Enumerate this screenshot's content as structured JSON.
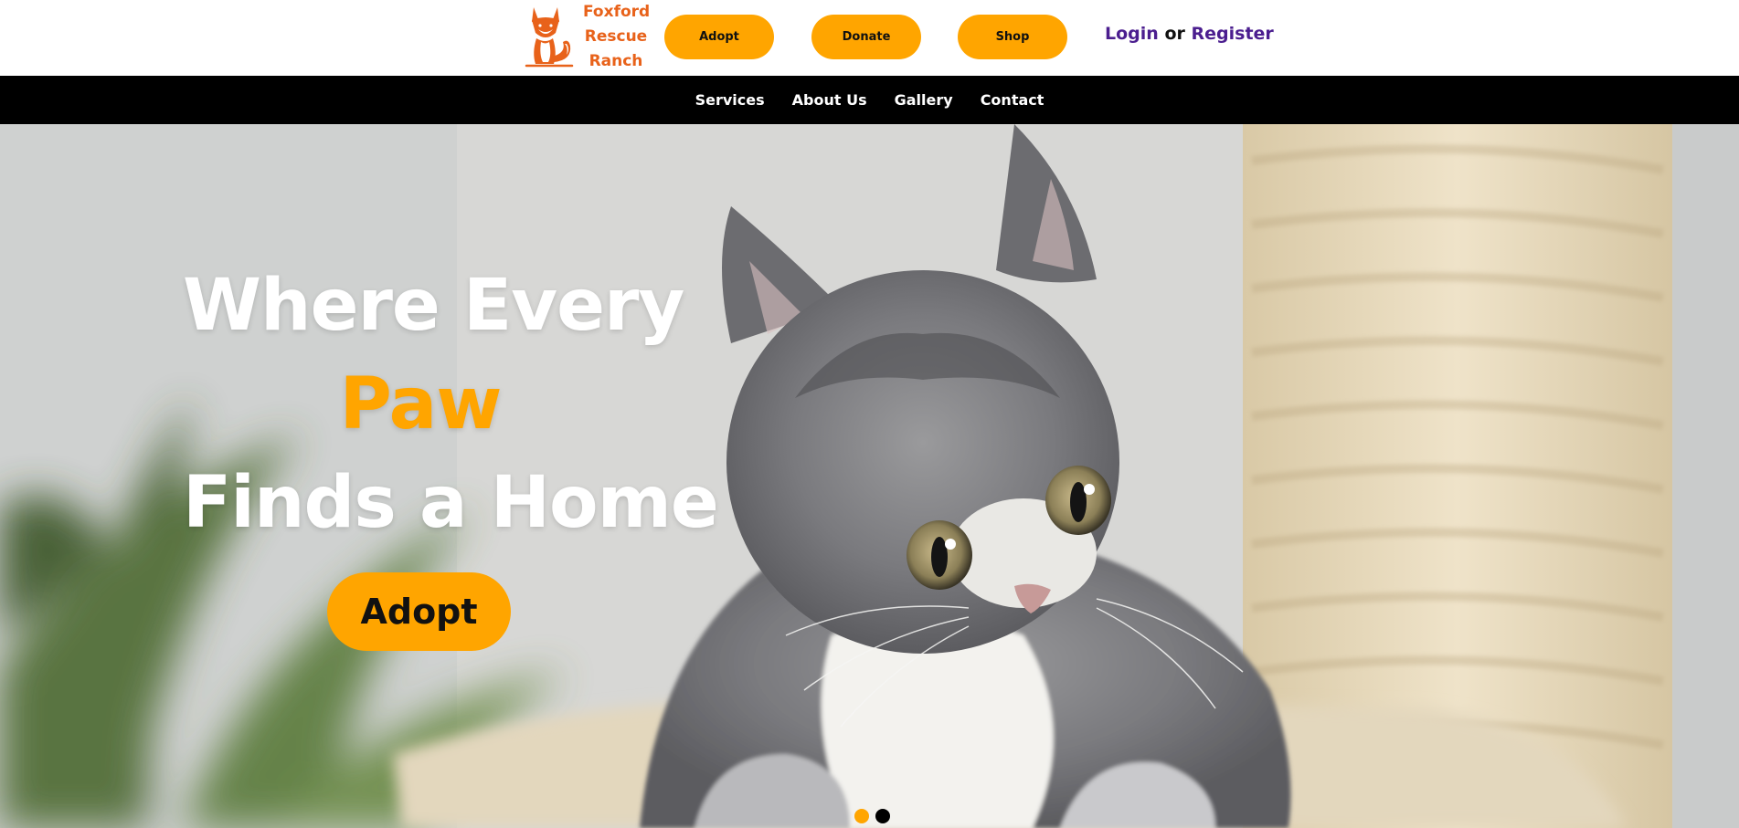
{
  "brand": {
    "name_lines": [
      "Foxford",
      "Rescue",
      "Ranch"
    ],
    "logo_icon": "fox-logo-icon",
    "color": "#e8621a"
  },
  "header": {
    "buttons": [
      {
        "label": "Adopt"
      },
      {
        "label": "Donate"
      },
      {
        "label": "Shop"
      }
    ],
    "auth": {
      "login": "Login",
      "separator": "or",
      "register": "Register"
    },
    "accent_color": "#ffa500",
    "link_color": "#4b1e8f"
  },
  "nav": {
    "items": [
      {
        "label": "Services"
      },
      {
        "label": "About Us"
      },
      {
        "label": "Gallery"
      },
      {
        "label": "Contact"
      }
    ]
  },
  "hero": {
    "image_subject": "kitten-photo",
    "headline": {
      "line1": "Where Every",
      "line2": "Paw",
      "line3": "Finds a Home"
    },
    "cta_label": "Adopt",
    "slides": {
      "count": 2,
      "active_index": 0
    }
  }
}
